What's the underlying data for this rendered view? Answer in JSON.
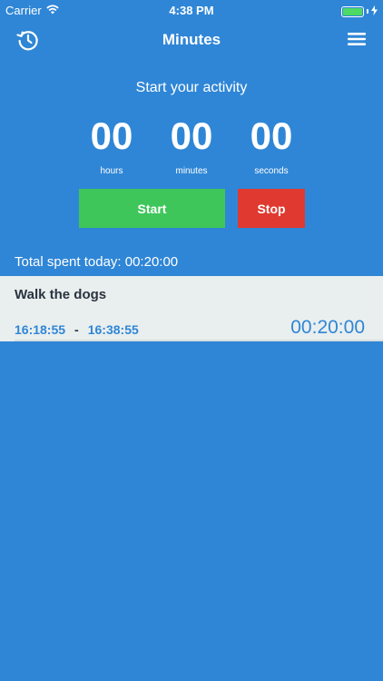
{
  "status_bar": {
    "carrier": "Carrier",
    "time": "4:38 PM",
    "battery_color": "#4cd964"
  },
  "nav": {
    "title": "Minutes",
    "left_icon": "history-clock-icon",
    "right_icon": "hamburger-menu-icon"
  },
  "timer": {
    "prompt": "Start your activity",
    "hours": "00",
    "minutes": "00",
    "seconds": "00",
    "hours_label": "hours",
    "minutes_label": "minutes",
    "seconds_label": "seconds"
  },
  "buttons": {
    "start_label": "Start",
    "stop_label": "Stop",
    "start_color": "#3fc65a",
    "stop_color": "#e0392f"
  },
  "summary": {
    "total_text": "Total spent today: 00:20:00"
  },
  "activities": [
    {
      "name": "Walk the dogs",
      "start": "16:18:55",
      "separator": "-",
      "end": "16:38:55",
      "duration": "00:20:00"
    }
  ],
  "colors": {
    "background": "#2f86d6",
    "row_background": "#e9eeee"
  }
}
